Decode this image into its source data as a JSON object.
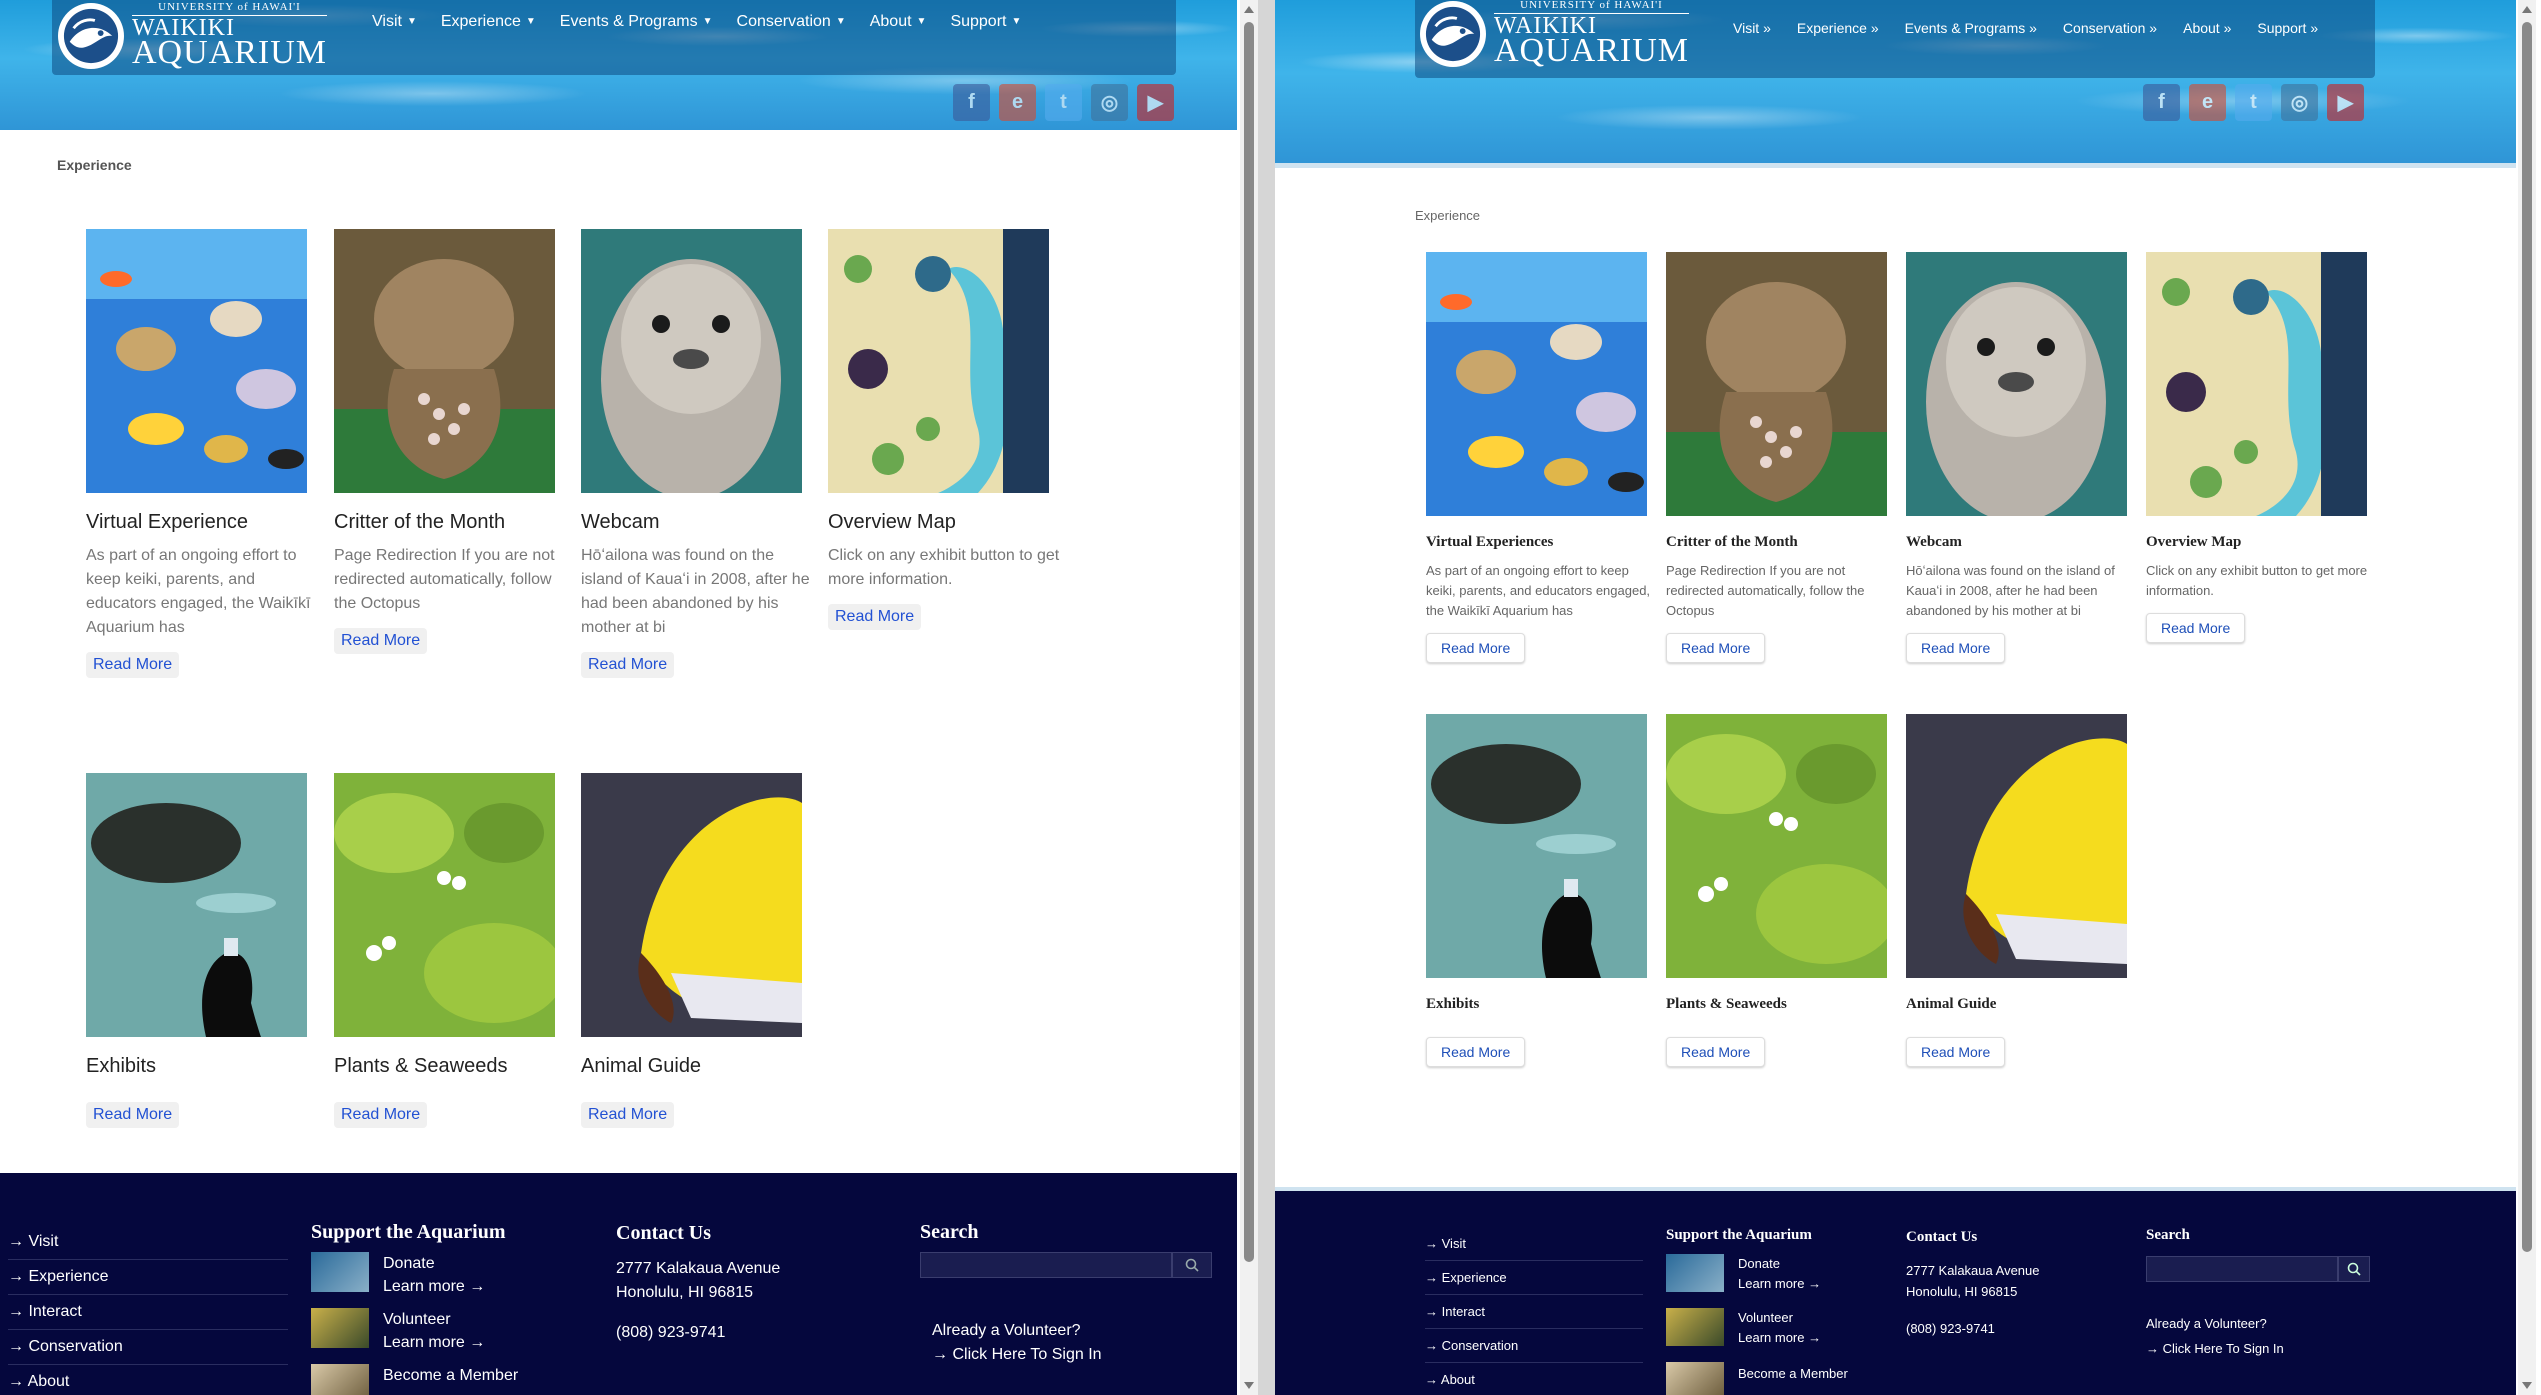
{
  "site": {
    "logo": {
      "university": "UNIVERSITY of HAWAI'I",
      "line1": "WAIKIKI",
      "line2": "AQUARIUM"
    },
    "menu": [
      "Visit",
      "Experience",
      "Events & Programs",
      "Conservation",
      "About",
      "Support"
    ],
    "socials": [
      "facebook-icon",
      "eventbrite-icon",
      "twitter-icon",
      "instagram-icon",
      "youtube-icon"
    ],
    "breadcrumb": "Experience"
  },
  "left": {
    "cards": [
      {
        "title": "Virtual Experience",
        "desc": "As part of an ongoing effort to keep keiki, parents, and educators engaged, the Waikīkī Aquarium has",
        "more": "Read More"
      },
      {
        "title": "Critter of the Month",
        "desc": "Page Redirection If you are not redirected automatically, follow the Octopus",
        "more": "Read More"
      },
      {
        "title": "Webcam",
        "desc": "Hōʻailona was found on the island of Kauaʻi in 2008, after he had been abandoned by his mother at bi",
        "more": "Read More"
      },
      {
        "title": "Overview Map",
        "desc": "Click on any exhibit button to get more information.",
        "more": "Read More"
      },
      {
        "title": "Exhibits",
        "desc": "",
        "more": "Read More"
      },
      {
        "title": "Plants & Seaweeds",
        "desc": "",
        "more": "Read More"
      },
      {
        "title": "Animal Guide",
        "desc": "",
        "more": "Read More"
      }
    ]
  },
  "right": {
    "cards": [
      {
        "title": "Virtual Experiences",
        "desc": "As part of an ongoing effort to keep keiki, parents, and educators engaged, the Waikīkī Aquarium has",
        "more": "Read More"
      },
      {
        "title": "Critter of the Month",
        "desc": "Page Redirection If you are not redirected automatically, follow the Octopus",
        "more": "Read More"
      },
      {
        "title": "Webcam",
        "desc": "Hōʻailona was found on the island of Kauaʻi in 2008, after he had been abandoned by his mother at bi",
        "more": "Read More"
      },
      {
        "title": "Overview Map",
        "desc": "Click on any exhibit button to get more information.",
        "more": "Read More"
      },
      {
        "title": "Exhibits",
        "desc": "",
        "more": "Read More"
      },
      {
        "title": "Plants & Seaweeds",
        "desc": "",
        "more": "Read More"
      },
      {
        "title": "Animal Guide",
        "desc": "",
        "more": "Read More"
      }
    ]
  },
  "footer": {
    "links": [
      "Visit",
      "Experience",
      "Interact",
      "Conservation",
      "About"
    ],
    "support_title": "Support the Aquarium",
    "support": [
      {
        "title": "Donate",
        "more": "Learn more →"
      },
      {
        "title": "Volunteer",
        "more": "Learn more →"
      },
      {
        "title": "Become a Member",
        "more": ""
      }
    ],
    "contact_title": "Contact Us",
    "address1": "2777 Kalakaua Avenue",
    "address2": "Honolulu, HI 96815",
    "phone": "(808) 923-9741",
    "search_title": "Search",
    "volunteer_q": "Already a Volunteer?",
    "volunteer_link": "Click Here To Sign In"
  },
  "colors": {
    "footer": "#05073d",
    "link": "#2251d3",
    "water": "#2fa6e0"
  }
}
